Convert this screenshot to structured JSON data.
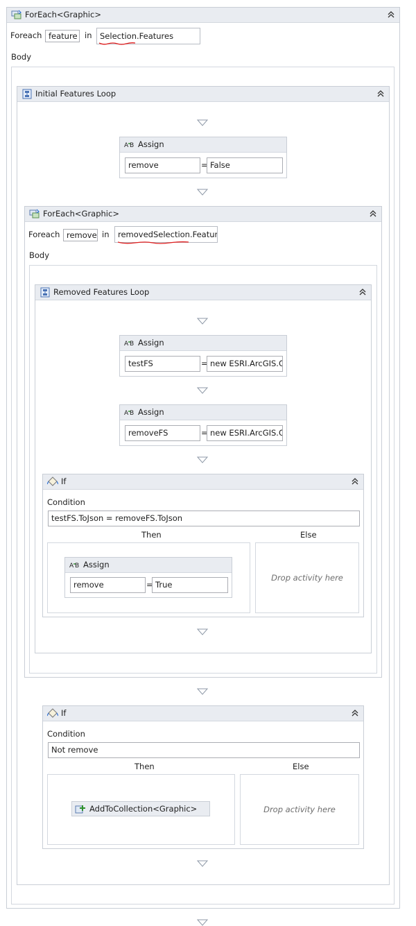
{
  "outer_foreach": {
    "title": "ForEach<Graphic>",
    "foreach_label": "Foreach",
    "item_var": "feature",
    "in_label": "in",
    "collection": "Selection.Features",
    "body_label": "Body"
  },
  "initial_loop": {
    "title": "Initial Features Loop",
    "assign": {
      "title": "Assign",
      "to": "remove",
      "eq": "=",
      "value": "False"
    },
    "inner_foreach": {
      "title": "ForEach<Graphic>",
      "foreach_label": "Foreach",
      "item_var": "removed",
      "in_label": "in",
      "collection": "removedSelection.Feature",
      "body_label": "Body",
      "removed_loop": {
        "title": "Removed Features Loop",
        "assign1": {
          "title": "Assign",
          "to": "testFS",
          "eq": "=",
          "value": "new ESRI.ArcGIS.Cl"
        },
        "assign2": {
          "title": "Assign",
          "to": "removeFS",
          "eq": "=",
          "value": "new ESRI.ArcGIS.Cl"
        },
        "if1": {
          "title": "If",
          "condition_label": "Condition",
          "condition": "testFS.ToJson = removeFS.ToJson",
          "then_label": "Then",
          "else_label": "Else",
          "then_assign": {
            "title": "Assign",
            "to": "remove",
            "eq": "=",
            "value": "True"
          },
          "else_drop": "Drop activity here"
        }
      }
    },
    "if2": {
      "title": "If",
      "condition_label": "Condition",
      "condition": "Not remove",
      "then_label": "Then",
      "else_label": "Else",
      "then_activity": "AddToCollection<Graphic>",
      "else_drop": "Drop activity here"
    }
  },
  "colors": {
    "header": "#e9ecf1",
    "border": "#c9ced6",
    "error_squiggle": "#e11d1d",
    "drop_text": "#6d6d6d"
  },
  "icons": [
    "foreach-icon",
    "sequence-icon",
    "assign-icon",
    "if-icon",
    "add-to-collection-icon",
    "collapse-chevron-icon",
    "drop-arrow-icon"
  ]
}
